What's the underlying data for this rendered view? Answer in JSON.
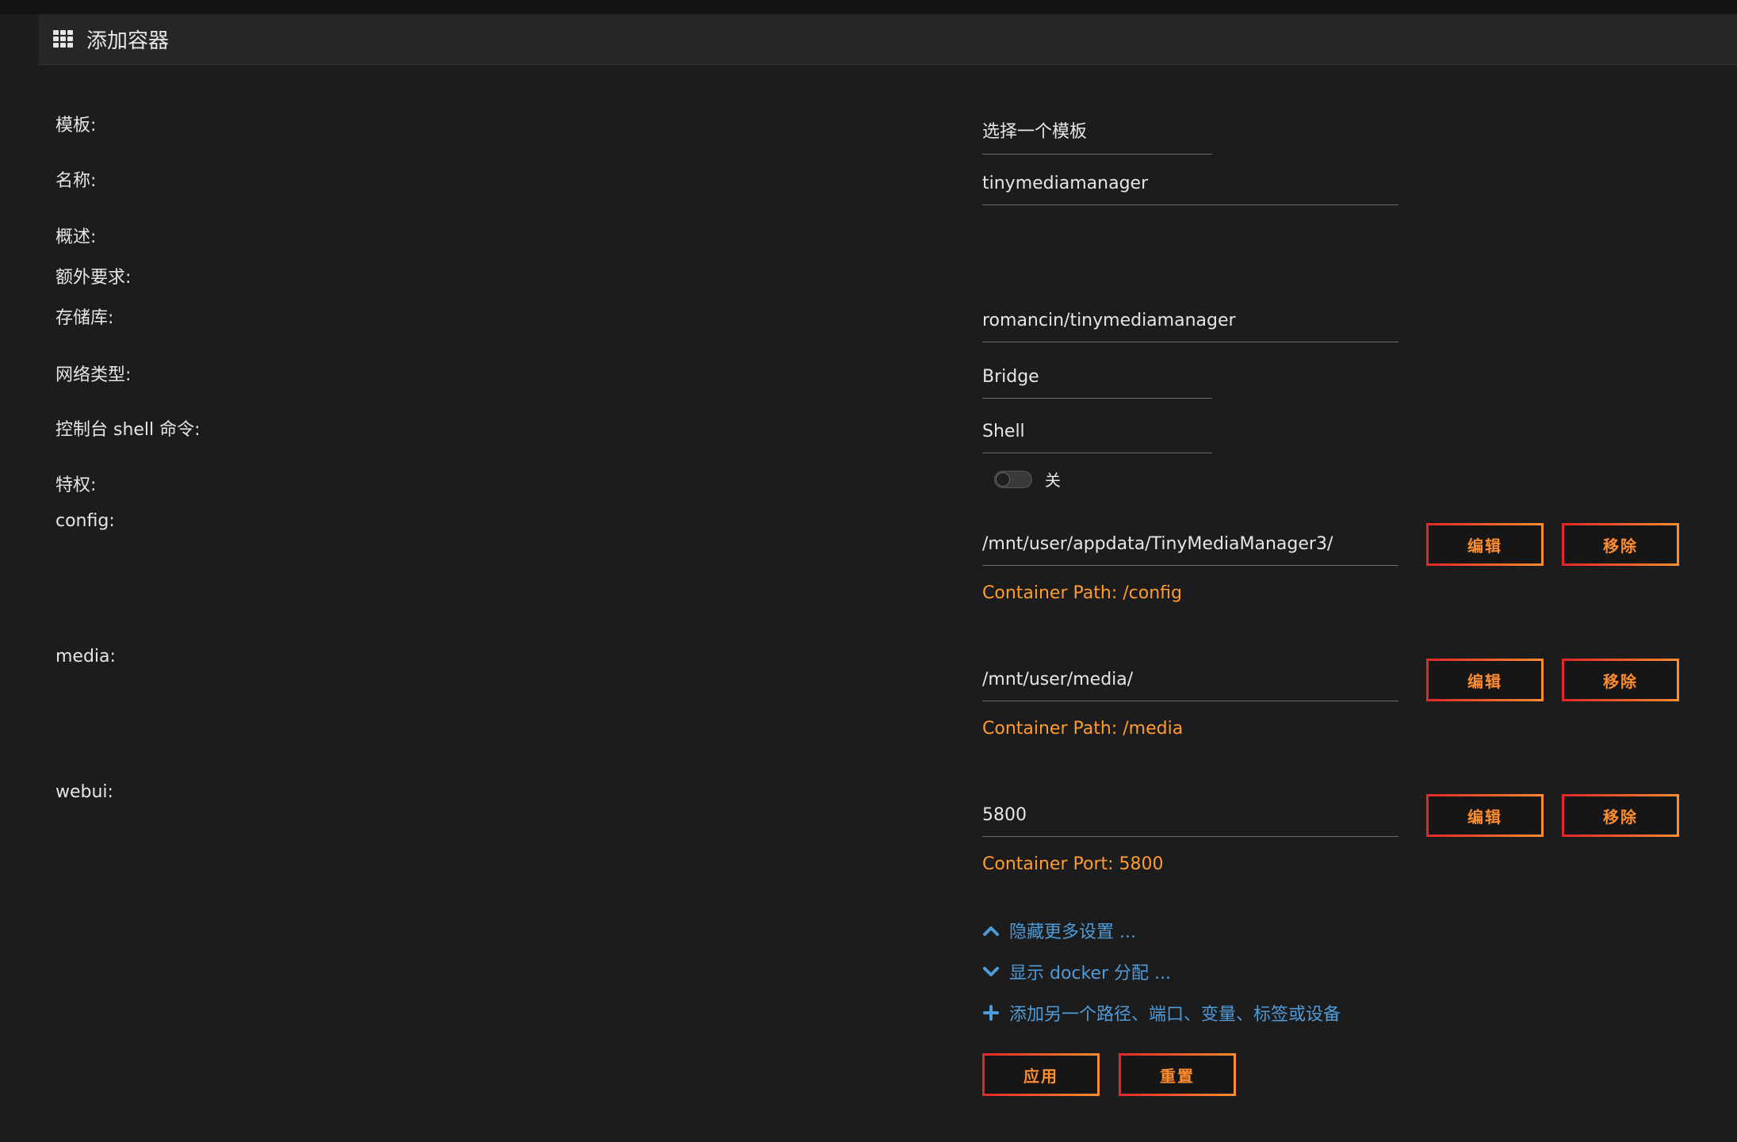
{
  "header": {
    "title": "添加容器",
    "icon": "grid-icon"
  },
  "colors": {
    "background": "#1c1c1c",
    "accent_orange": "#ff8c2f",
    "accent_red": "#e22828",
    "link_blue": "#4f9bd9"
  },
  "form": {
    "template": {
      "label": "模板:",
      "value": "选择一个模板"
    },
    "name": {
      "label": "名称:",
      "value": "tinymediamanager"
    },
    "overview": {
      "label": "概述:"
    },
    "requires": {
      "label": "额外要求:"
    },
    "repository": {
      "label": "存储库:",
      "value": "romancin/tinymediamanager"
    },
    "network": {
      "label": "网络类型:",
      "value": "Bridge"
    },
    "shell": {
      "label": "控制台 shell 命令:",
      "value": "Shell"
    },
    "privileged": {
      "label": "特权:",
      "state": "关"
    }
  },
  "mappings": [
    {
      "label": "config:",
      "value": "/mnt/user/appdata/TinyMediaManager3/",
      "container_info": "Container Path: /config",
      "edit_label": "编辑",
      "remove_label": "移除"
    },
    {
      "label": "media:",
      "value": "/mnt/user/media/",
      "container_info": "Container Path: /media",
      "edit_label": "编辑",
      "remove_label": "移除"
    },
    {
      "label": "webui:",
      "value": "5800",
      "container_info": "Container Port: 5800",
      "edit_label": "编辑",
      "remove_label": "移除"
    }
  ],
  "links": {
    "hide_more": "隐藏更多设置 ...",
    "show_docker": "显示 docker 分配 ...",
    "add_another": "添加另一个路径、端口、变量、标签或设备"
  },
  "actions": {
    "apply": "应用",
    "reset": "重置"
  }
}
